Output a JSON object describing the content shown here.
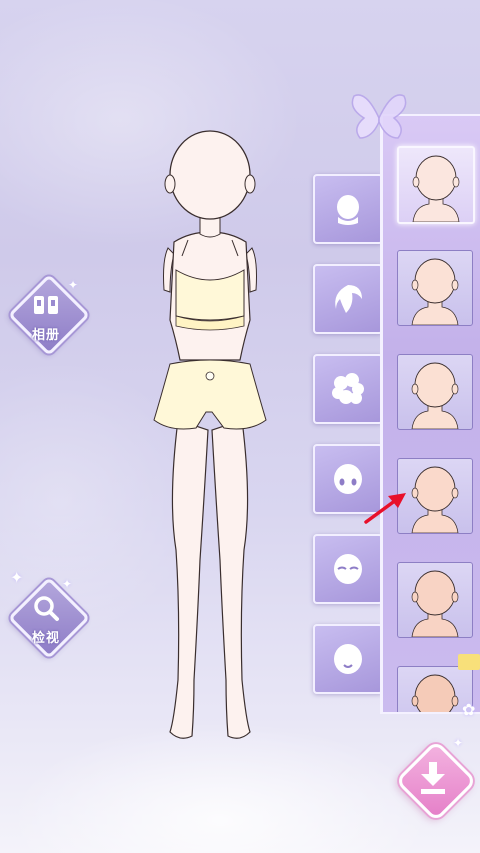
{
  "side_buttons": {
    "album": {
      "label": "相册",
      "icon": "album-icon"
    },
    "inspect": {
      "label": "检视",
      "icon": "magnifier-icon"
    }
  },
  "category_tabs": [
    {
      "id": "face",
      "icon": "face-icon"
    },
    {
      "id": "hair",
      "icon": "hair-icon"
    },
    {
      "id": "hairstyle",
      "icon": "curly-hair-icon"
    },
    {
      "id": "eyes",
      "icon": "eyes-icon"
    },
    {
      "id": "eyebrows",
      "icon": "eyebrow-icon"
    },
    {
      "id": "mouth",
      "icon": "mouth-icon"
    }
  ],
  "items": [
    {
      "id": "head-1",
      "skin": "#fbe6df",
      "selected": true
    },
    {
      "id": "head-2",
      "skin": "#fbe1d6",
      "selected": false
    },
    {
      "id": "head-3",
      "skin": "#fbe0d3",
      "selected": false
    },
    {
      "id": "head-4",
      "skin": "#fad9cb",
      "selected": false
    },
    {
      "id": "head-5",
      "skin": "#f8d3c4",
      "selected": false
    },
    {
      "id": "head-6",
      "skin": "#f5cbb8",
      "selected": false
    }
  ],
  "colors": {
    "accent": "#a797db",
    "download": "#e57fc8",
    "pointer_arrow": "#e8102a"
  }
}
